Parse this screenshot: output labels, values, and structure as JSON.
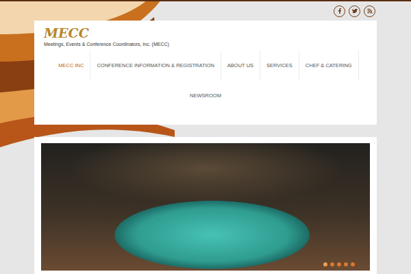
{
  "logo": {
    "title": "MECC",
    "tagline": "Meetings, Events & Conference Coordinators, Inc. (MECC)"
  },
  "nav": [
    {
      "label": "MECC INC",
      "selected": true
    },
    {
      "label": "CONFERENCE INFORMATION & REGISTRATION",
      "selected": false
    },
    {
      "label": "ABOUT US",
      "selected": false
    },
    {
      "label": "SERVICES",
      "selected": false
    },
    {
      "label": "CHEF & CATERING",
      "selected": false
    },
    {
      "label": "NEWSROOM",
      "selected": false
    }
  ],
  "slider": {
    "dots": [
      {
        "selected": true
      },
      {
        "selected": false
      },
      {
        "selected": false
      },
      {
        "selected": false
      },
      {
        "selected": false
      }
    ]
  }
}
